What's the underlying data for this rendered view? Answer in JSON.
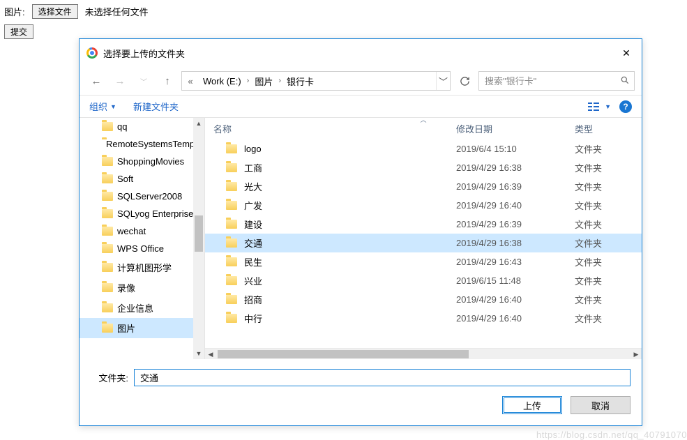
{
  "host": {
    "label": "图片:",
    "choose_btn": "选择文件",
    "no_file": "未选择任何文件",
    "submit": "提交"
  },
  "dialog": {
    "title": "选择要上传的文件夹",
    "breadcrumb": {
      "seg0": "Work (E:)",
      "seg1": "图片",
      "seg2": "银行卡"
    },
    "search_placeholder": "搜索\"银行卡\"",
    "toolbar": {
      "organize": "组织",
      "new_folder": "新建文件夹"
    },
    "columns": {
      "name": "名称",
      "date": "修改日期",
      "type": "类型"
    },
    "tree": [
      {
        "label": "qq"
      },
      {
        "label": "RemoteSystemsTempFiles"
      },
      {
        "label": "ShoppingMovies"
      },
      {
        "label": "Soft"
      },
      {
        "label": "SQLServer2008"
      },
      {
        "label": "SQLyog Enterprise"
      },
      {
        "label": "wechat"
      },
      {
        "label": "WPS Office"
      },
      {
        "label": "计算机图形学"
      },
      {
        "label": "录像"
      },
      {
        "label": "企业信息"
      },
      {
        "label": "图片"
      }
    ],
    "rows": [
      {
        "name": "logo",
        "date": "2019/6/4 15:10",
        "type": "文件夹"
      },
      {
        "name": "工商",
        "date": "2019/4/29 16:38",
        "type": "文件夹"
      },
      {
        "name": "光大",
        "date": "2019/4/29 16:39",
        "type": "文件夹"
      },
      {
        "name": "广发",
        "date": "2019/4/29 16:40",
        "type": "文件夹"
      },
      {
        "name": "建设",
        "date": "2019/4/29 16:39",
        "type": "文件夹"
      },
      {
        "name": "交通",
        "date": "2019/4/29 16:38",
        "type": "文件夹"
      },
      {
        "name": "民生",
        "date": "2019/4/29 16:43",
        "type": "文件夹"
      },
      {
        "name": "兴业",
        "date": "2019/6/15 11:48",
        "type": "文件夹"
      },
      {
        "name": "招商",
        "date": "2019/4/29 16:40",
        "type": "文件夹"
      },
      {
        "name": "中行",
        "date": "2019/4/29 16:40",
        "type": "文件夹"
      }
    ],
    "selected_row_index": 5,
    "picker_label": "文件夹:",
    "picker_value": "交通",
    "upload": "上传",
    "cancel": "取消"
  },
  "watermark": "https://blog.csdn.net/qq_40791070"
}
